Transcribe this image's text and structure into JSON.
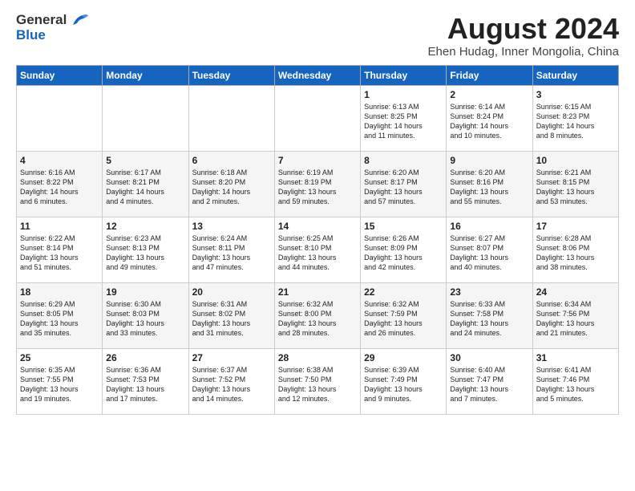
{
  "header": {
    "logo_general": "General",
    "logo_blue": "Blue",
    "month_year": "August 2024",
    "location": "Ehen Hudag, Inner Mongolia, China"
  },
  "days_of_week": [
    "Sunday",
    "Monday",
    "Tuesday",
    "Wednesday",
    "Thursday",
    "Friday",
    "Saturday"
  ],
  "weeks": [
    [
      {
        "day": "",
        "content": ""
      },
      {
        "day": "",
        "content": ""
      },
      {
        "day": "",
        "content": ""
      },
      {
        "day": "",
        "content": ""
      },
      {
        "day": "1",
        "content": "Sunrise: 6:13 AM\nSunset: 8:25 PM\nDaylight: 14 hours\nand 11 minutes."
      },
      {
        "day": "2",
        "content": "Sunrise: 6:14 AM\nSunset: 8:24 PM\nDaylight: 14 hours\nand 10 minutes."
      },
      {
        "day": "3",
        "content": "Sunrise: 6:15 AM\nSunset: 8:23 PM\nDaylight: 14 hours\nand 8 minutes."
      }
    ],
    [
      {
        "day": "4",
        "content": "Sunrise: 6:16 AM\nSunset: 8:22 PM\nDaylight: 14 hours\nand 6 minutes."
      },
      {
        "day": "5",
        "content": "Sunrise: 6:17 AM\nSunset: 8:21 PM\nDaylight: 14 hours\nand 4 minutes."
      },
      {
        "day": "6",
        "content": "Sunrise: 6:18 AM\nSunset: 8:20 PM\nDaylight: 14 hours\nand 2 minutes."
      },
      {
        "day": "7",
        "content": "Sunrise: 6:19 AM\nSunset: 8:19 PM\nDaylight: 13 hours\nand 59 minutes."
      },
      {
        "day": "8",
        "content": "Sunrise: 6:20 AM\nSunset: 8:17 PM\nDaylight: 13 hours\nand 57 minutes."
      },
      {
        "day": "9",
        "content": "Sunrise: 6:20 AM\nSunset: 8:16 PM\nDaylight: 13 hours\nand 55 minutes."
      },
      {
        "day": "10",
        "content": "Sunrise: 6:21 AM\nSunset: 8:15 PM\nDaylight: 13 hours\nand 53 minutes."
      }
    ],
    [
      {
        "day": "11",
        "content": "Sunrise: 6:22 AM\nSunset: 8:14 PM\nDaylight: 13 hours\nand 51 minutes."
      },
      {
        "day": "12",
        "content": "Sunrise: 6:23 AM\nSunset: 8:13 PM\nDaylight: 13 hours\nand 49 minutes."
      },
      {
        "day": "13",
        "content": "Sunrise: 6:24 AM\nSunset: 8:11 PM\nDaylight: 13 hours\nand 47 minutes."
      },
      {
        "day": "14",
        "content": "Sunrise: 6:25 AM\nSunset: 8:10 PM\nDaylight: 13 hours\nand 44 minutes."
      },
      {
        "day": "15",
        "content": "Sunrise: 6:26 AM\nSunset: 8:09 PM\nDaylight: 13 hours\nand 42 minutes."
      },
      {
        "day": "16",
        "content": "Sunrise: 6:27 AM\nSunset: 8:07 PM\nDaylight: 13 hours\nand 40 minutes."
      },
      {
        "day": "17",
        "content": "Sunrise: 6:28 AM\nSunset: 8:06 PM\nDaylight: 13 hours\nand 38 minutes."
      }
    ],
    [
      {
        "day": "18",
        "content": "Sunrise: 6:29 AM\nSunset: 8:05 PM\nDaylight: 13 hours\nand 35 minutes."
      },
      {
        "day": "19",
        "content": "Sunrise: 6:30 AM\nSunset: 8:03 PM\nDaylight: 13 hours\nand 33 minutes."
      },
      {
        "day": "20",
        "content": "Sunrise: 6:31 AM\nSunset: 8:02 PM\nDaylight: 13 hours\nand 31 minutes."
      },
      {
        "day": "21",
        "content": "Sunrise: 6:32 AM\nSunset: 8:00 PM\nDaylight: 13 hours\nand 28 minutes."
      },
      {
        "day": "22",
        "content": "Sunrise: 6:32 AM\nSunset: 7:59 PM\nDaylight: 13 hours\nand 26 minutes."
      },
      {
        "day": "23",
        "content": "Sunrise: 6:33 AM\nSunset: 7:58 PM\nDaylight: 13 hours\nand 24 minutes."
      },
      {
        "day": "24",
        "content": "Sunrise: 6:34 AM\nSunset: 7:56 PM\nDaylight: 13 hours\nand 21 minutes."
      }
    ],
    [
      {
        "day": "25",
        "content": "Sunrise: 6:35 AM\nSunset: 7:55 PM\nDaylight: 13 hours\nand 19 minutes."
      },
      {
        "day": "26",
        "content": "Sunrise: 6:36 AM\nSunset: 7:53 PM\nDaylight: 13 hours\nand 17 minutes."
      },
      {
        "day": "27",
        "content": "Sunrise: 6:37 AM\nSunset: 7:52 PM\nDaylight: 13 hours\nand 14 minutes."
      },
      {
        "day": "28",
        "content": "Sunrise: 6:38 AM\nSunset: 7:50 PM\nDaylight: 13 hours\nand 12 minutes."
      },
      {
        "day": "29",
        "content": "Sunrise: 6:39 AM\nSunset: 7:49 PM\nDaylight: 13 hours\nand 9 minutes."
      },
      {
        "day": "30",
        "content": "Sunrise: 6:40 AM\nSunset: 7:47 PM\nDaylight: 13 hours\nand 7 minutes."
      },
      {
        "day": "31",
        "content": "Sunrise: 6:41 AM\nSunset: 7:46 PM\nDaylight: 13 hours\nand 5 minutes."
      }
    ]
  ]
}
